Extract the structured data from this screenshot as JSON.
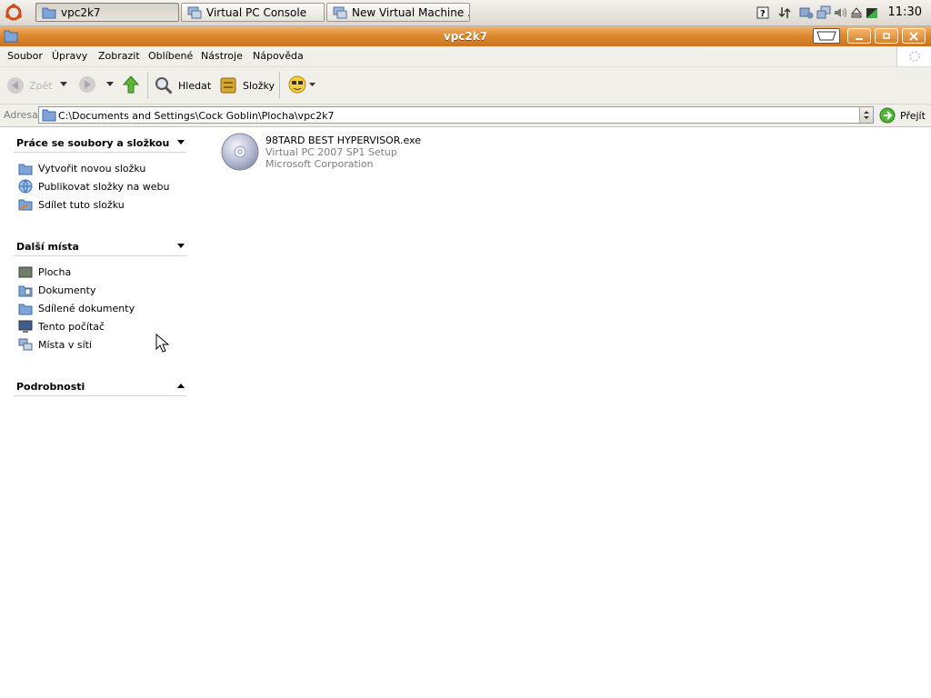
{
  "panel": {
    "tasks": [
      {
        "label": "vpc2k7",
        "icon": "folder-icon",
        "active": true
      },
      {
        "label": "Virtual PC Console",
        "icon": "virtual-pc-icon",
        "active": false
      },
      {
        "label": "New Virtual Machine ...",
        "icon": "virtual-pc-icon",
        "active": false
      }
    ],
    "clock": "11:30"
  },
  "window": {
    "title": "vpc2k7"
  },
  "menu": [
    "Soubor",
    "Úpravy",
    "Zobrazit",
    "Oblíbené",
    "Nástroje",
    "Nápověda"
  ],
  "toolbar": {
    "back": "Zpět",
    "search": "Hledat",
    "folders": "Složky"
  },
  "address": {
    "label": "Adresa",
    "path": "C:\\Documents and Settings\\Cock Goblin\\Plocha\\vpc2k7",
    "go": "Přejít"
  },
  "sidebar": {
    "file_tasks": {
      "title": "Práce se soubory a složkou",
      "items": [
        "Vytvořit novou složku",
        "Publikovat složky na webu",
        "Sdílet tuto složku"
      ]
    },
    "other_places": {
      "title": "Další místa",
      "items": [
        "Plocha",
        "Dokumenty",
        "Sdílené dokumenty",
        "Tento počítač",
        "Místa v síti"
      ]
    },
    "details": {
      "title": "Podrobnosti"
    }
  },
  "files": [
    {
      "name": "98TARD BEST HYPERVISOR.exe",
      "description": "Virtual PC 2007 SP1 Setup",
      "company": "Microsoft Corporation"
    }
  ]
}
